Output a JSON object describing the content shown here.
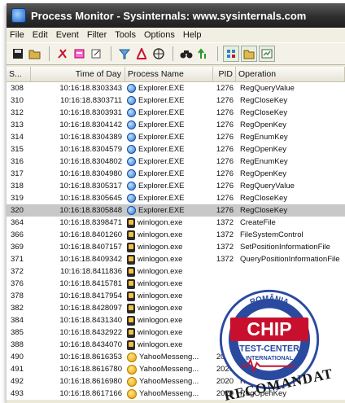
{
  "window": {
    "title": "Process Monitor - Sysinternals: www.sysinternals.com"
  },
  "menu": [
    "File",
    "Edit",
    "Event",
    "Filter",
    "Tools",
    "Options",
    "Help"
  ],
  "columns": {
    "seq": "S...",
    "time": "Time of Day",
    "process": "Process Name",
    "pid": "PID",
    "operation": "Operation"
  },
  "rows": [
    {
      "seq": "308",
      "time": "10:16:18.8303343",
      "process": "Explorer.EXE",
      "icon": "explorer-icon",
      "pid": "1276",
      "op": "RegQueryValue"
    },
    {
      "seq": "310",
      "time": "10:16:18.8303711",
      "process": "Explorer.EXE",
      "icon": "explorer-icon",
      "pid": "1276",
      "op": "RegCloseKey"
    },
    {
      "seq": "312",
      "time": "10:16:18.8303931",
      "process": "Explorer.EXE",
      "icon": "explorer-icon",
      "pid": "1276",
      "op": "RegCloseKey"
    },
    {
      "seq": "313",
      "time": "10:16:18.8304142",
      "process": "Explorer.EXE",
      "icon": "explorer-icon",
      "pid": "1276",
      "op": "RegOpenKey"
    },
    {
      "seq": "314",
      "time": "10:16:18.8304389",
      "process": "Explorer.EXE",
      "icon": "explorer-icon",
      "pid": "1276",
      "op": "RegEnumKey"
    },
    {
      "seq": "315",
      "time": "10:16:18.8304579",
      "process": "Explorer.EXE",
      "icon": "explorer-icon",
      "pid": "1276",
      "op": "RegOpenKey"
    },
    {
      "seq": "316",
      "time": "10:16:18.8304802",
      "process": "Explorer.EXE",
      "icon": "explorer-icon",
      "pid": "1276",
      "op": "RegEnumKey"
    },
    {
      "seq": "317",
      "time": "10:16:18.8304980",
      "process": "Explorer.EXE",
      "icon": "explorer-icon",
      "pid": "1276",
      "op": "RegOpenKey"
    },
    {
      "seq": "318",
      "time": "10:16:18.8305317",
      "process": "Explorer.EXE",
      "icon": "explorer-icon",
      "pid": "1276",
      "op": "RegQueryValue"
    },
    {
      "seq": "319",
      "time": "10:16:18.8305645",
      "process": "Explorer.EXE",
      "icon": "explorer-icon",
      "pid": "1276",
      "op": "RegCloseKey"
    },
    {
      "seq": "320",
      "time": "10:16:18.8305848",
      "process": "Explorer.EXE",
      "icon": "explorer-icon",
      "pid": "1276",
      "op": "RegCloseKey",
      "selected": true
    },
    {
      "seq": "364",
      "time": "10:16:18.8398471",
      "process": "winlogon.exe",
      "icon": "winlogon-icon",
      "pid": "1372",
      "op": "CreateFile"
    },
    {
      "seq": "366",
      "time": "10:16:18.8401260",
      "process": "winlogon.exe",
      "icon": "winlogon-icon",
      "pid": "1372",
      "op": "FileSystemControl"
    },
    {
      "seq": "369",
      "time": "10:16:18.8407157",
      "process": "winlogon.exe",
      "icon": "winlogon-icon",
      "pid": "1372",
      "op": "SetPositionInformationFile"
    },
    {
      "seq": "371",
      "time": "10:16:18.8409342",
      "process": "winlogon.exe",
      "icon": "winlogon-icon",
      "pid": "1372",
      "op": "QueryPositionInformationFile"
    },
    {
      "seq": "372",
      "time": "10:16:18.8411836",
      "process": "winlogon.exe",
      "icon": "winlogon-icon",
      "pid": "",
      "op": ""
    },
    {
      "seq": "376",
      "time": "10:16:18.8415781",
      "process": "winlogon.exe",
      "icon": "winlogon-icon",
      "pid": "",
      "op": ""
    },
    {
      "seq": "378",
      "time": "10:16:18.8417954",
      "process": "winlogon.exe",
      "icon": "winlogon-icon",
      "pid": "",
      "op": ""
    },
    {
      "seq": "382",
      "time": "10:16:18.8428097",
      "process": "winlogon.exe",
      "icon": "winlogon-icon",
      "pid": "",
      "op": ""
    },
    {
      "seq": "384",
      "time": "10:16:18.8431340",
      "process": "winlogon.exe",
      "icon": "winlogon-icon",
      "pid": "",
      "op": ""
    },
    {
      "seq": "385",
      "time": "10:16:18.8432922",
      "process": "winlogon.exe",
      "icon": "winlogon-icon",
      "pid": "",
      "op": ""
    },
    {
      "seq": "388",
      "time": "10:16:18.8434070",
      "process": "winlogon.exe",
      "icon": "winlogon-icon",
      "pid": "",
      "op": ""
    },
    {
      "seq": "490",
      "time": "10:16:18.8616353",
      "process": "YahooMesseng...",
      "icon": "yahoo-icon",
      "pid": "2020",
      "op": ""
    },
    {
      "seq": "491",
      "time": "10:16:18.8616780",
      "process": "YahooMesseng...",
      "icon": "yahoo-icon",
      "pid": "2020",
      "op": "RegOpenKey"
    },
    {
      "seq": "492",
      "time": "10:16:18.8616980",
      "process": "YahooMesseng...",
      "icon": "yahoo-icon",
      "pid": "2020",
      "op": "RegOpenKey"
    },
    {
      "seq": "493",
      "time": "10:16:18.8617166",
      "process": "YahooMesseng...",
      "icon": "yahoo-icon",
      "pid": "2020",
      "op": "RegOpenKey"
    }
  ],
  "badge": {
    "country": "ROMÂNIA",
    "brand": "CHIP",
    "line1": "TEST-CENTER",
    "line2": "INTERNATIONAL",
    "ribbon": "RECOMANDAT"
  },
  "colors": {
    "badge_red": "#c8102e",
    "badge_blue": "#2a4aa0",
    "selected_row": "#c8c8c8"
  }
}
